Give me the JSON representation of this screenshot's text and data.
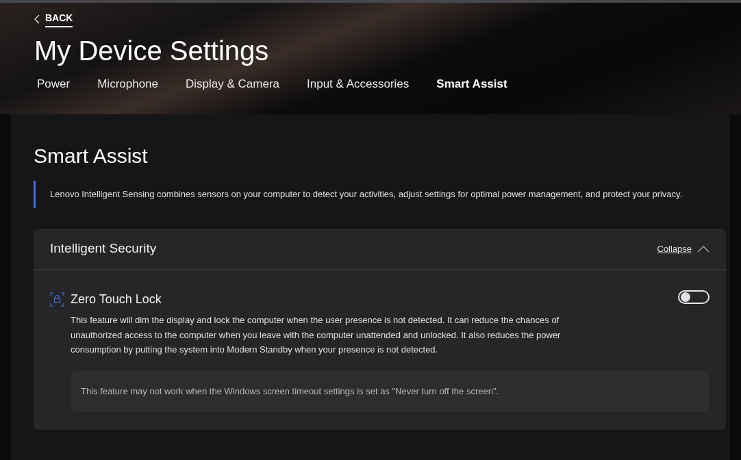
{
  "back_link": {
    "label": "BACK"
  },
  "page_title": "My Device Settings",
  "tabs": [
    {
      "label": "Power",
      "selected": false
    },
    {
      "label": "Microphone",
      "selected": false
    },
    {
      "label": "Display & Camera",
      "selected": false
    },
    {
      "label": "Input & Accessories",
      "selected": false
    },
    {
      "label": "Smart Assist",
      "selected": true
    }
  ],
  "section": {
    "title": "Smart Assist",
    "description": "Lenovo Intelligent Sensing combines sensors on your computer to detect your activities, adjust settings for optimal power management, and protect your privacy."
  },
  "card": {
    "title": "Intelligent Security",
    "collapse_label": "Collapse",
    "expanded": true,
    "features": [
      {
        "title": "Zero Touch Lock",
        "on": false,
        "description": "This feature will dim the display and lock the computer when the user presence is not detected. It can reduce the chances of unauthorized access to the computer when you leave with the computer unattended and unlocked. It also reduces the power consumption by putting the system into Modern Standby when your presence is not detected.",
        "note": "This feature may not work when the Windows screen timeout settings is set as \"Never turn off the screen\"."
      }
    ]
  }
}
